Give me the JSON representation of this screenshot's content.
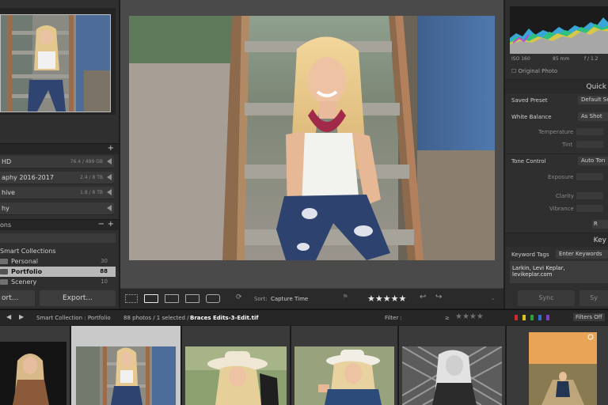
{
  "left_panel": {
    "folders_header": "",
    "drives": [
      {
        "name": "HD",
        "size": "76.4 / 499 GB"
      },
      {
        "name": "aphy 2016-2017",
        "size": "2.4 / 8 TB"
      },
      {
        "name": "hive",
        "size": "1.8 / 8 TB"
      },
      {
        "name": "hy",
        "size": ""
      }
    ],
    "collections_header": "ons",
    "collections": [
      {
        "name": "Smart Collections",
        "count": ""
      },
      {
        "name": "Personal",
        "count": "30"
      },
      {
        "name": "Portfolio",
        "count": "88"
      },
      {
        "name": "Scenery",
        "count": "10"
      }
    ],
    "import_label": "ort...",
    "export_label": "Export..."
  },
  "toolbar": {
    "sort_label": "Sort:",
    "sort_value": "Capture Time",
    "rating_stars": "★★★★★"
  },
  "right_panel": {
    "histogram": {
      "iso": "ISO 160",
      "focal": "85 mm",
      "aperture": "f / 1.2",
      "original_photo": "Original Photo"
    },
    "quick_title": "Quick",
    "saved_preset_label": "Saved Preset",
    "saved_preset_value": "Default Se",
    "white_balance_label": "White Balance",
    "white_balance_value": "As Shot",
    "temperature_label": "Temperature",
    "tint_label": "Tint",
    "tone_control_label": "Tone Control",
    "auto_tone_label": "Auto Ton",
    "exposure_label": "Exposure",
    "clarity_label": "Clarity",
    "vibrance_label": "Vibrance",
    "reset_label": "R",
    "keywording_title": "Key",
    "keyword_tags_label": "Keyword Tags",
    "keyword_tags_value": "Enter Keywords",
    "keywords_text": "Larkin, Levi Keplar, levikeplar.com",
    "sync_label": "Sync",
    "sync2_label": "Sy"
  },
  "filmstrip_bar": {
    "source": "Smart Collection : Portfolio",
    "count": "88 photos / 1 selected /",
    "filename": "Braces Edits-3-Edit.tif",
    "filter_label": "Filter :",
    "filter_stars": "★★★★",
    "filters_off": "Filters Off"
  },
  "colors": {
    "accent_selected": "#c9c9c9",
    "panel_bg": "#2f2f2f",
    "center_bg": "#4a4a4a",
    "flag_red": "#d02a2a",
    "flag_yellow": "#d4c21d",
    "flag_green": "#2e9e3a",
    "flag_blue": "#2f6fd0",
    "flag_purple": "#7b3fbf"
  }
}
